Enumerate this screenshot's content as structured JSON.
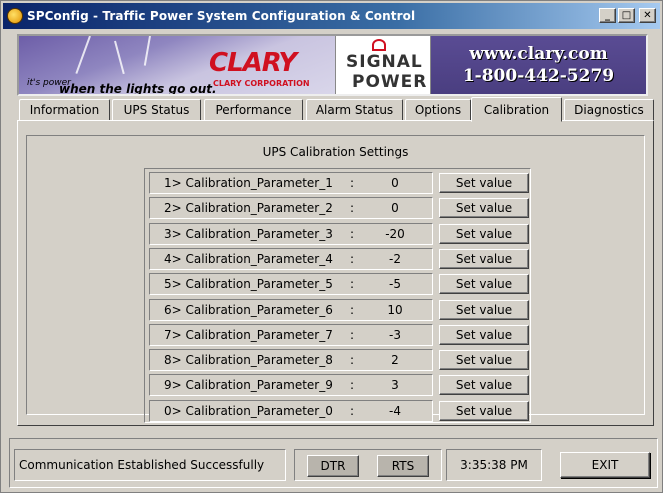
{
  "window": {
    "title": "SPConfig - Traffic Power System Configuration & Control"
  },
  "banner": {
    "tagline_small": "it's power",
    "tagline_main": "when the lights go out.",
    "company_logo": "CLARY",
    "company_name": "CLARY CORPORATION",
    "product_line1": "SIGNAL",
    "product_line2": "POWER",
    "website": "www.clary.com",
    "phone": "1-800-442-5279"
  },
  "tabs": [
    {
      "label": "Information"
    },
    {
      "label": "UPS Status"
    },
    {
      "label": "Performance"
    },
    {
      "label": "Alarm Status"
    },
    {
      "label": "Options"
    },
    {
      "label": "Calibration"
    },
    {
      "label": "Diagnostics"
    }
  ],
  "active_tab": "Calibration",
  "calibration": {
    "title": "UPS Calibration Settings",
    "button_label": "Set value",
    "separator": ":",
    "params": [
      {
        "name": "1> Calibration_Parameter_1",
        "value": "0"
      },
      {
        "name": "2> Calibration_Parameter_2",
        "value": "0"
      },
      {
        "name": "3> Calibration_Parameter_3",
        "value": "-20"
      },
      {
        "name": "4> Calibration_Parameter_4",
        "value": "-2"
      },
      {
        "name": "5> Calibration_Parameter_5",
        "value": "-5"
      },
      {
        "name": "6> Calibration_Parameter_6",
        "value": "10"
      },
      {
        "name": "7> Calibration_Parameter_7",
        "value": "-3"
      },
      {
        "name": "8> Calibration_Parameter_8",
        "value": "2"
      },
      {
        "name": "9> Calibration_Parameter_9",
        "value": "3"
      },
      {
        "name": "0> Calibration_Parameter_0",
        "value": "-4"
      }
    ]
  },
  "status": {
    "message": "Communication Established Successfully",
    "dtr_label": "DTR",
    "rts_label": "RTS",
    "time": "3:35:38 PM",
    "exit_label": "EXIT"
  }
}
